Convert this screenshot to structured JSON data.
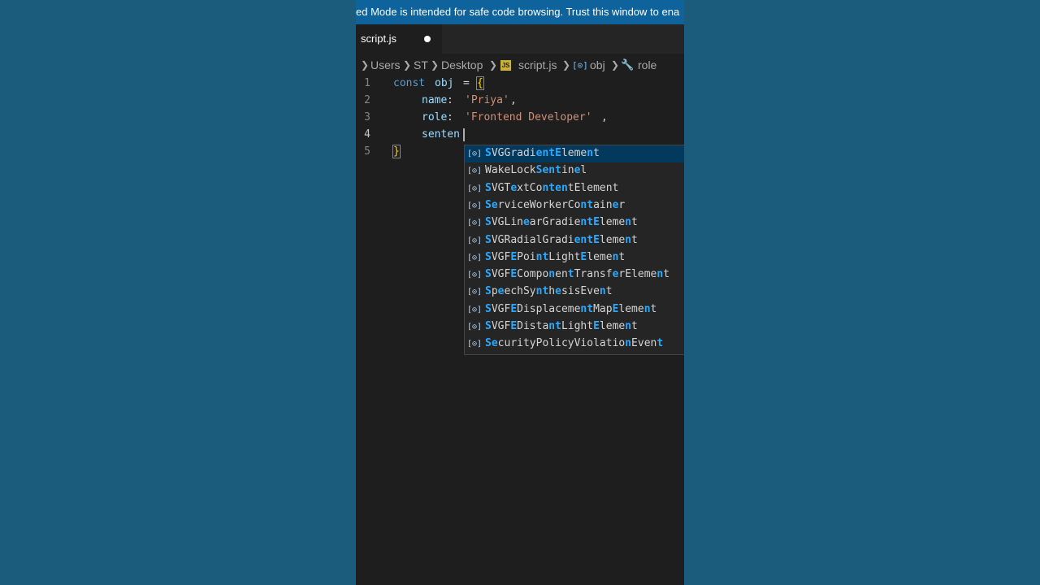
{
  "banner": {
    "text": "ed Mode is intended for safe code browsing. Trust this window to ena"
  },
  "tab": {
    "label": "script.js"
  },
  "breadcrumb": {
    "items": [
      "Users",
      "ST",
      "Desktop",
      "script.js",
      "obj",
      "role"
    ],
    "js_badge": "JS"
  },
  "code": {
    "line_numbers": [
      "1",
      "2",
      "3",
      "4",
      "5"
    ],
    "line1": {
      "kw": "const",
      "name": "obj",
      "op": "=",
      "brace": "{"
    },
    "line2": {
      "key": "name",
      "colon": ":",
      "value": "'Priya'",
      "comma": ","
    },
    "line3": {
      "key": "role",
      "colon": ":",
      "value": "'Frontend Developer'",
      "comma": ","
    },
    "line4": {
      "typed": "senten"
    },
    "line5": {
      "brace": "}"
    }
  },
  "suggestions": [
    "SVGGradientElement",
    "WakeLockSentinel",
    "SVGTextContentElement",
    "ServiceWorkerContainer",
    "SVGLinearGradientElement",
    "SVGRadialGradientElement",
    "SVGFEPointLightElement",
    "SVGFEComponentTransferElement",
    "SpeechSynthesisEvent",
    "SVGFEDisplacementMapElement",
    "SVGFEDistantLightElement",
    "SecurityPolicyViolationEvent"
  ],
  "suggestion_highlight_query": "senten",
  "colors": {
    "banner": "#0e639c",
    "editor_bg": "#1e1e1e",
    "outer_bg": "#1b5b7c",
    "match_highlight": "#2aaaff",
    "selected_row": "#04395e"
  },
  "icons": {
    "suggestion_kind": "symbol-variable-icon",
    "tab_dirty": "unsaved-dot-icon",
    "breadcrumb_role": "wrench-icon"
  }
}
